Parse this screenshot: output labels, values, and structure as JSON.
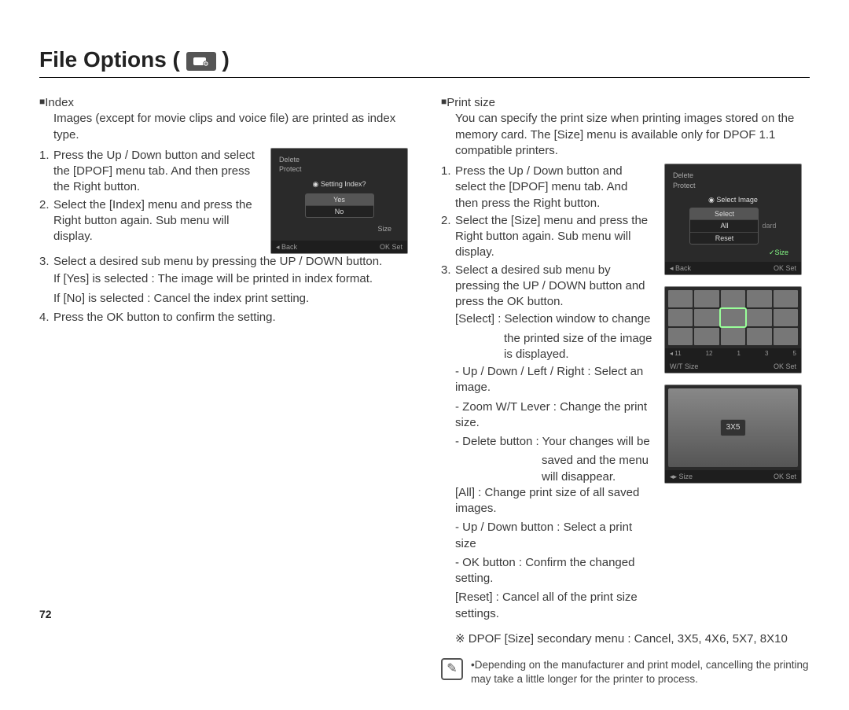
{
  "title": "File Options (",
  "title_close": ")",
  "page_number": "72",
  "left": {
    "index_label": "Index",
    "index_intro": "Images (except for movie clips and voice file) are printed as index type.",
    "s1": "Press the Up / Down button and select the [DPOF] menu tab. And then press the Right button.",
    "s2": "Select the [Index] menu and press the Right button again. Sub menu will display.",
    "s3": "Select a desired sub menu by pressing the UP / DOWN button.",
    "s3a": "If [Yes] is selected : The image will be printed in index format.",
    "s3b": "If [No] is selected   : Cancel the index print setting.",
    "s4": "Press the OK button to confirm the setting.",
    "fig1": {
      "menu_top": [
        "Delete",
        "Protect"
      ],
      "popup_title": "Setting Index?",
      "popup_items": [
        "Yes",
        "No"
      ],
      "menu_bottom": "Size",
      "bar_left": "Back",
      "bar_right": "Set"
    }
  },
  "right": {
    "size_label": "Print size",
    "size_intro": "You can specify the print size when printing images stored on the memory card. The [Size] menu is available only for DPOF 1.1 compatible printers.",
    "s1": "Press the Up / Down button and select the [DPOF] menu tab. And then press the Right button.",
    "s2": "Select the [Size] menu and press the Right button again. Sub menu will display.",
    "s3": "Select a desired sub menu by pressing the UP / DOWN button and press the OK button.",
    "select_line": "[Select] : Selection window to change",
    "select_line2": "the printed size of the image is displayed.",
    "d1": "- Up / Down / Left / Right : Select an image.",
    "d2": "- Zoom W/T Lever : Change the print size.",
    "d3": "- Delete button : Your changes will be",
    "d3b": "saved and the menu will disappear.",
    "all_line": "[All] : Change print size of all saved images.",
    "d4": "- Up / Down button : Select a print size",
    "d5": "- OK button : Confirm the changed setting.",
    "reset_line": "[Reset] : Cancel all of the print size settings.",
    "secondary": "DPOF [Size] secondary menu : Cancel, 3X5, 4X6, 5X7, 8X10",
    "note": "Depending on the manufacturer and print model, cancelling the printing may take a little longer for the printer to process.",
    "fig1": {
      "menu_top": [
        "Delete",
        "Protect"
      ],
      "popup_title": "Select Image",
      "popup_items": [
        "Select",
        "All",
        "Reset"
      ],
      "tag": "Size",
      "std": "dard",
      "bar_left": "Back",
      "bar_right": "Set"
    },
    "fig2": {
      "bar_left": "Size",
      "bar_right": "Set",
      "nums": [
        "11",
        "12",
        "1",
        "3",
        "5"
      ]
    },
    "fig3": {
      "size_label": "3X5",
      "bar_left": "Size",
      "bar_right": "Set"
    }
  }
}
